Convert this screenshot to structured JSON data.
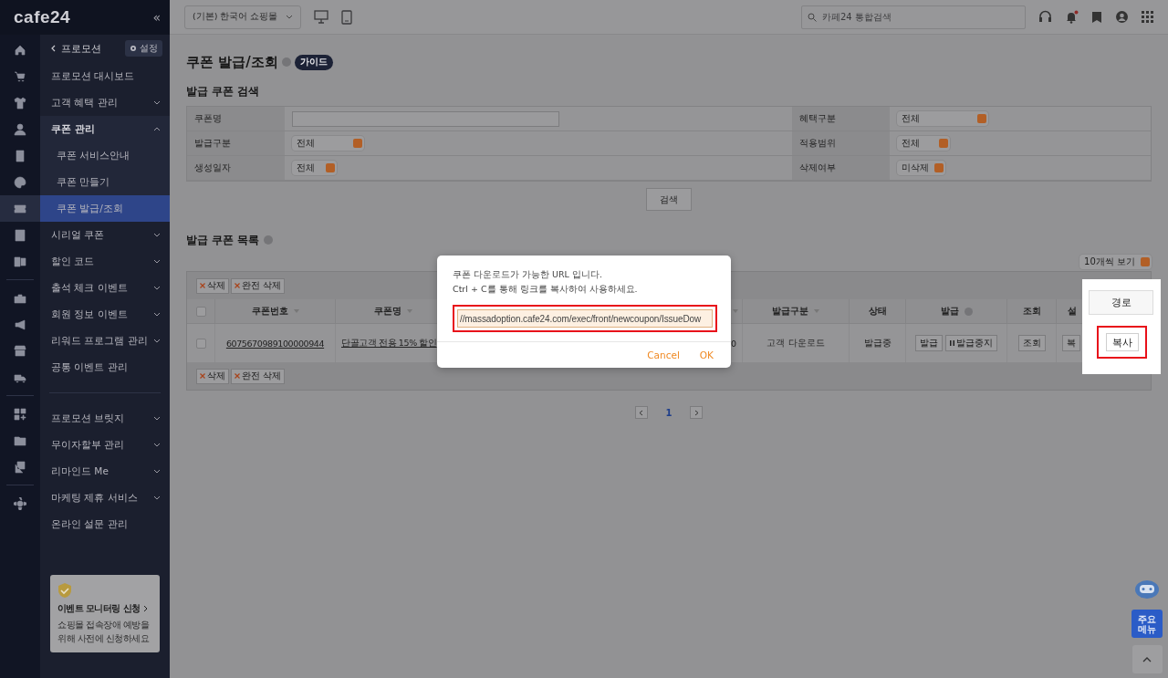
{
  "brand": {
    "logo": "cafe24",
    "collapse": "«"
  },
  "rail": [
    {
      "selected": false
    },
    {
      "selected": false
    },
    {
      "selected": false
    },
    {
      "selected": false
    },
    {
      "selected": false
    },
    {
      "selected": false
    },
    {
      "selected": true
    },
    {
      "selected": false
    },
    {
      "selected": false
    },
    {
      "selected": false
    },
    {
      "selected": false
    },
    {
      "selected": false
    },
    {
      "selected": false
    },
    {
      "selected": false
    },
    {
      "selected": false
    },
    {
      "selected": false
    },
    {
      "selected": false
    }
  ],
  "sidebar": {
    "back": "프로모션",
    "settings": "설정",
    "groups": [
      [
        {
          "label": "프로모션 대시보드",
          "expandable": false,
          "expanded": false
        },
        {
          "label": "고객 혜택 관리",
          "expandable": true,
          "expanded": false
        },
        {
          "label": "쿠폰 관리",
          "expandable": true,
          "expanded": true,
          "children": [
            {
              "label": "쿠폰 서비스안내",
              "selected": false
            },
            {
              "label": "쿠폰 만들기",
              "selected": false
            },
            {
              "label": "쿠폰 발급/조회",
              "selected": true
            }
          ]
        },
        {
          "label": "시리얼 쿠폰",
          "expandable": true,
          "expanded": false
        },
        {
          "label": "할인 코드",
          "expandable": true,
          "expanded": false
        },
        {
          "label": "출석 체크 이벤트",
          "expandable": true,
          "expanded": false
        },
        {
          "label": "회원 정보 이벤트",
          "expandable": true,
          "expanded": false
        },
        {
          "label": "리워드 프로그램 관리",
          "expandable": true,
          "expanded": false
        },
        {
          "label": "공통 이벤트 관리",
          "expandable": false,
          "expanded": false
        }
      ],
      [
        {
          "label": "프로모션 브릿지",
          "expandable": true,
          "expanded": false
        },
        {
          "label": "무이자할부 관리",
          "expandable": true,
          "expanded": false
        },
        {
          "label": "리마인드 Me",
          "expandable": true,
          "expanded": false
        },
        {
          "label": "마케팅 제휴 서비스",
          "expandable": true,
          "expanded": false
        },
        {
          "label": "온라인 설문 관리",
          "expandable": false,
          "expanded": false
        }
      ]
    ],
    "card": {
      "title": "이벤트 모니터링 신청",
      "text": "쇼핑몰 접속장애 예방을 위해 사전에 신청하세요"
    }
  },
  "topbar": {
    "shop": "(기본) 한국어 쇼핑몰",
    "search_placeholder": "카페24 통합검색"
  },
  "page": {
    "title": "쿠폰 발급/조회",
    "guide": "가이드",
    "search_title": "발급 쿠폰 검색",
    "search_rows": [
      [
        {
          "label": "쿠폰명",
          "kind": "text"
        },
        {
          "label": "혜택구분",
          "kind": "select",
          "value": "전체"
        }
      ],
      [
        {
          "label": "발급구분",
          "kind": "select",
          "value": "전체"
        },
        {
          "label": "적용범위",
          "kind": "select",
          "value": "전체"
        }
      ],
      [
        {
          "label": "생성일자",
          "kind": "select",
          "value": "전체"
        },
        {
          "label": "삭제여부",
          "kind": "select",
          "value": "미삭제"
        }
      ]
    ],
    "search_button": "검색",
    "list_title": "발급 쿠폰 목록",
    "page_size": "10개씩 보기",
    "toolbar_top": [
      "삭제",
      "완전 삭제"
    ],
    "toolbar_bottom": [
      "삭제",
      "완전 삭제"
    ],
    "table": {
      "select_all_checked": false,
      "columns": [
        "",
        "쿠폰번호",
        "쿠폰명",
        "",
        "발급구분",
        "상태",
        "발급",
        "조회",
        "설"
      ],
      "rows": [
        {
          "checked": false,
          "number": "6075670989100000944",
          "name": "단골고객 전용 15% 할인",
          "column_4": "0",
          "issue_type": "고객 다운로드",
          "status": "발급중",
          "issue_buttons": [
            "발급",
            "발급중지"
          ],
          "view_button": "조회",
          "setting_button": "복"
        }
      ]
    },
    "pagination": {
      "pages": [
        {
          "label": "1",
          "selected": true
        }
      ]
    }
  },
  "modal": {
    "lines": [
      "쿠폰 다운로드가 가능한 URL 입니다.",
      "Ctrl + C를 통해 링크를 복사하여 사용하세요."
    ],
    "url": "//massadoption.cafe24.com/exec/front/newcoupon/IssueDow",
    "cancel": "Cancel",
    "ok": "OK"
  },
  "callout": {
    "header": "경로",
    "button": "복사"
  },
  "floating": {
    "menu": "주요 메뉴"
  }
}
